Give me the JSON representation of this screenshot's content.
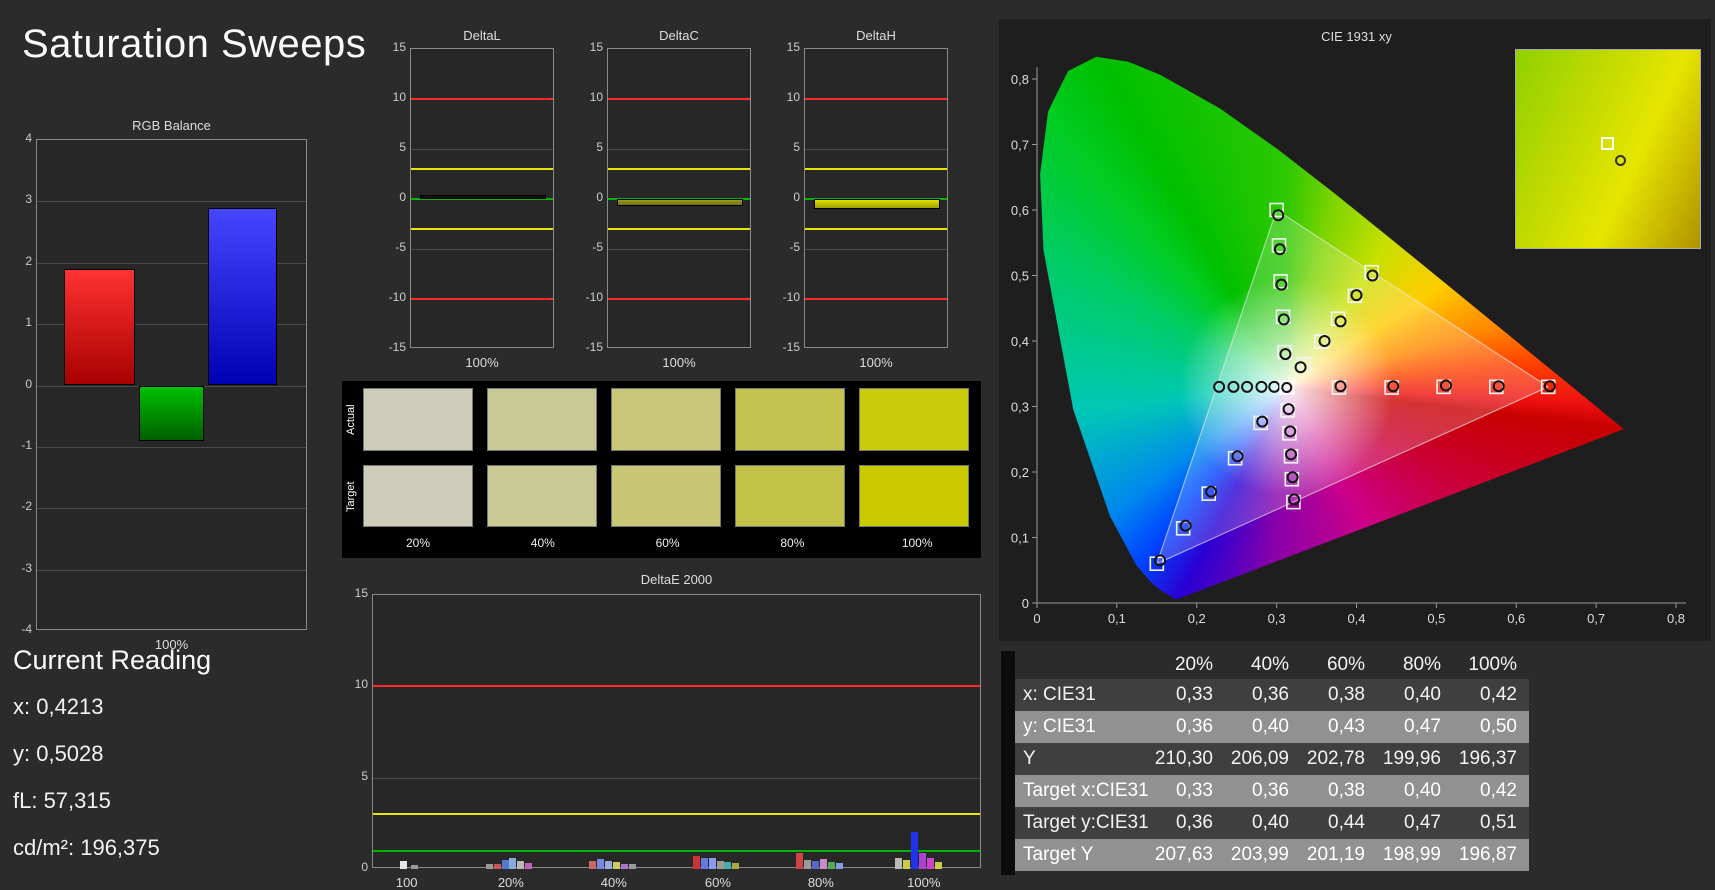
{
  "page": {
    "title": "Saturation Sweeps"
  },
  "current_reading": {
    "title": "Current Reading",
    "lines": [
      "x: 0,4213",
      "y: 0,5028",
      "fL: 57,315",
      "cd/m²: 196,375"
    ]
  },
  "swatches": {
    "col_labels": [
      "20%",
      "40%",
      "60%",
      "80%",
      "100%"
    ],
    "rows": [
      {
        "name": "Actual",
        "colors": [
          "#cdcdb9",
          "#c9c995",
          "#c8c878",
          "#c4c44e",
          "#cbcb0e"
        ]
      },
      {
        "name": "Target",
        "colors": [
          "#cdcdb9",
          "#c9c993",
          "#c7c775",
          "#c3c34a",
          "#c9c900"
        ]
      }
    ]
  },
  "chart_data": [
    {
      "id": "rgb_balance",
      "type": "bar",
      "title": "RGB Balance",
      "x_label": "100%",
      "ylim": [
        -4,
        4
      ],
      "yticks": [
        4,
        3,
        2,
        1,
        0,
        -1,
        -2,
        -3,
        -4
      ],
      "grid": [
        3,
        2,
        1,
        0,
        -1,
        -2,
        -3
      ],
      "slots": [
        [
          0.1,
          0.36
        ],
        [
          0.375,
          0.615
        ],
        [
          0.63,
          0.885
        ]
      ],
      "series": [
        {
          "name": "Red",
          "value": 1.9,
          "color": "#ff3232",
          "color2": "#a80000"
        },
        {
          "name": "Green",
          "value": -0.9,
          "color": "#00c000",
          "color2": "#006000"
        },
        {
          "name": "Blue",
          "value": 2.9,
          "color": "#4646ff",
          "color2": "#0000b4"
        }
      ]
    },
    {
      "id": "deltaL",
      "type": "bar",
      "title": "DeltaL",
      "x_label": "100%",
      "ylim": [
        -15,
        15
      ],
      "yticks": [
        15,
        10,
        5,
        0,
        -5,
        -10,
        -15
      ],
      "grid": [
        5,
        -5
      ],
      "ref_lines": [
        {
          "value": 10,
          "color": "#ff2a2a"
        },
        {
          "value": 3,
          "color": "#e6e600"
        },
        {
          "value": 0,
          "color": "#00b400"
        },
        {
          "value": -3,
          "color": "#e6e600"
        },
        {
          "value": -10,
          "color": "#ff2a2a"
        }
      ],
      "slots": [
        [
          0.06,
          0.94
        ]
      ],
      "series": [
        {
          "name": "DeltaL",
          "value": 0.4,
          "color": "#161616",
          "color2": "#050505"
        }
      ]
    },
    {
      "id": "deltaC",
      "type": "bar",
      "title": "DeltaC",
      "x_label": "100%",
      "ylim": [
        -15,
        15
      ],
      "yticks": [
        15,
        10,
        5,
        0,
        -5,
        -10,
        -15
      ],
      "grid": [
        5,
        -5
      ],
      "ref_lines": [
        {
          "value": 10,
          "color": "#ff2a2a"
        },
        {
          "value": 3,
          "color": "#e6e600"
        },
        {
          "value": 0,
          "color": "#00b400"
        },
        {
          "value": -3,
          "color": "#e6e600"
        },
        {
          "value": -10,
          "color": "#ff2a2a"
        }
      ],
      "slots": [
        [
          0.06,
          0.94
        ]
      ],
      "series": [
        {
          "name": "DeltaC",
          "value": -0.7,
          "color": "#9c9c24",
          "color2": "#6f6f12"
        }
      ]
    },
    {
      "id": "deltaH",
      "type": "bar",
      "title": "DeltaH",
      "x_label": "100%",
      "ylim": [
        -15,
        15
      ],
      "yticks": [
        15,
        10,
        5,
        0,
        -5,
        -10,
        -15
      ],
      "grid": [
        5,
        -5
      ],
      "ref_lines": [
        {
          "value": 10,
          "color": "#ff2a2a"
        },
        {
          "value": 3,
          "color": "#e6e600"
        },
        {
          "value": 0,
          "color": "#00b400"
        },
        {
          "value": -3,
          "color": "#e6e600"
        },
        {
          "value": -10,
          "color": "#ff2a2a"
        }
      ],
      "slots": [
        [
          0.06,
          0.94
        ]
      ],
      "series": [
        {
          "name": "DeltaH",
          "value": -1.0,
          "color": "#e0e000",
          "color2": "#a0a000"
        }
      ]
    },
    {
      "id": "deltaE",
      "type": "bar",
      "title": "DeltaE 2000",
      "ylim": [
        0,
        15
      ],
      "yticks": [
        15,
        10,
        5,
        0
      ],
      "grid": [
        5
      ],
      "ref_lines": [
        {
          "value": 10,
          "color": "#ff2a2a"
        },
        {
          "value": 3,
          "color": "#e6e600"
        },
        {
          "value": 1,
          "color": "#00b400"
        }
      ],
      "x_ticks": [
        {
          "pos": 0.057,
          "label": "100"
        },
        {
          "pos": 0.228,
          "label": "20%"
        },
        {
          "pos": 0.397,
          "label": "40%"
        },
        {
          "pos": 0.568,
          "label": "60%"
        },
        {
          "pos": 0.737,
          "label": "80%"
        },
        {
          "pos": 0.906,
          "label": "100%"
        }
      ],
      "bars": [
        {
          "pos": 0.05,
          "value": 0.45,
          "color": "#e8e8e8"
        },
        {
          "pos": 0.068,
          "value": 0.2,
          "color": "#9a9a9a"
        },
        {
          "pos": 0.19,
          "value": 0.3,
          "color": "#9a9a9a"
        },
        {
          "pos": 0.203,
          "value": 0.28,
          "color": "#cc5555"
        },
        {
          "pos": 0.216,
          "value": 0.5,
          "color": "#5577cc"
        },
        {
          "pos": 0.229,
          "value": 0.6,
          "color": "#88aadd"
        },
        {
          "pos": 0.242,
          "value": 0.42,
          "color": "#b9b9b9"
        },
        {
          "pos": 0.255,
          "value": 0.34,
          "color": "#bb66bb"
        },
        {
          "pos": 0.36,
          "value": 0.42,
          "color": "#cc6666"
        },
        {
          "pos": 0.373,
          "value": 0.55,
          "color": "#7788dd"
        },
        {
          "pos": 0.386,
          "value": 0.46,
          "color": "#99aadd"
        },
        {
          "pos": 0.399,
          "value": 0.36,
          "color": "#cccc66"
        },
        {
          "pos": 0.412,
          "value": 0.3,
          "color": "#aa77cc"
        },
        {
          "pos": 0.425,
          "value": 0.26,
          "color": "#9a9a9a"
        },
        {
          "pos": 0.53,
          "value": 0.72,
          "color": "#cc3333"
        },
        {
          "pos": 0.543,
          "value": 0.58,
          "color": "#6677dd"
        },
        {
          "pos": 0.556,
          "value": 0.62,
          "color": "#8899ee"
        },
        {
          "pos": 0.569,
          "value": 0.46,
          "color": "#9a9a9a"
        },
        {
          "pos": 0.582,
          "value": 0.4,
          "color": "#44aaaa"
        },
        {
          "pos": 0.595,
          "value": 0.34,
          "color": "#aaaa44"
        },
        {
          "pos": 0.7,
          "value": 0.85,
          "color": "#cc4444"
        },
        {
          "pos": 0.713,
          "value": 0.5,
          "color": "#9a9a9a"
        },
        {
          "pos": 0.726,
          "value": 0.46,
          "color": "#5566cc"
        },
        {
          "pos": 0.739,
          "value": 0.56,
          "color": "#cc88cc"
        },
        {
          "pos": 0.752,
          "value": 0.4,
          "color": "#55aa55"
        },
        {
          "pos": 0.765,
          "value": 0.34,
          "color": "#8899dd"
        },
        {
          "pos": 0.862,
          "value": 0.6,
          "color": "#b9b9b9"
        },
        {
          "pos": 0.875,
          "value": 0.5,
          "color": "#cccc44"
        },
        {
          "pos": 0.888,
          "value": 2.05,
          "color": "#2233ee"
        },
        {
          "pos": 0.901,
          "value": 0.85,
          "color": "#aa44cc"
        },
        {
          "pos": 0.914,
          "value": 0.62,
          "color": "#cc44cc"
        },
        {
          "pos": 0.927,
          "value": 0.38,
          "color": "#cccc44"
        }
      ]
    }
  ],
  "cie": {
    "title": "CIE 1931 xy",
    "x_ticks": [
      "0",
      "0,1",
      "0,2",
      "0,3",
      "0,4",
      "0,5",
      "0,6",
      "0,7",
      "0,8"
    ],
    "y_ticks": [
      "0",
      "0,1",
      "0,2",
      "0,3",
      "0,4",
      "0,5",
      "0,6",
      "0,7",
      "0,8"
    ],
    "white_point": [
      0.3127,
      0.329
    ],
    "gamut": [
      [
        0.64,
        0.33
      ],
      [
        0.3,
        0.6
      ],
      [
        0.15,
        0.06
      ]
    ],
    "locus": [
      [
        0.1741,
        0.005
      ],
      [
        0.1566,
        0.0177
      ],
      [
        0.144,
        0.0297
      ],
      [
        0.1241,
        0.0578
      ],
      [
        0.0913,
        0.1327
      ],
      [
        0.0454,
        0.295
      ],
      [
        0.0082,
        0.5384
      ],
      [
        0.0039,
        0.6548
      ],
      [
        0.0139,
        0.7502
      ],
      [
        0.0389,
        0.812
      ],
      [
        0.0743,
        0.8338
      ],
      [
        0.1142,
        0.8262
      ],
      [
        0.1547,
        0.8059
      ],
      [
        0.2296,
        0.7543
      ],
      [
        0.3016,
        0.6923
      ],
      [
        0.3731,
        0.6245
      ],
      [
        0.4441,
        0.5547
      ],
      [
        0.5125,
        0.4866
      ],
      [
        0.5752,
        0.4242
      ],
      [
        0.627,
        0.3725
      ],
      [
        0.6658,
        0.334
      ],
      [
        0.6915,
        0.3083
      ],
      [
        0.719,
        0.2809
      ],
      [
        0.7347,
        0.2653
      ]
    ],
    "targets": [
      [
        0.378,
        0.329
      ],
      [
        0.444,
        0.329
      ],
      [
        0.509,
        0.33
      ],
      [
        0.575,
        0.33
      ],
      [
        0.64,
        0.33
      ],
      [
        0.31,
        0.383
      ],
      [
        0.308,
        0.437
      ],
      [
        0.305,
        0.491
      ],
      [
        0.303,
        0.546
      ],
      [
        0.3,
        0.6
      ],
      [
        0.28,
        0.275
      ],
      [
        0.248,
        0.221
      ],
      [
        0.215,
        0.167
      ],
      [
        0.183,
        0.114
      ],
      [
        0.15,
        0.06
      ],
      [
        0.314,
        0.294
      ],
      [
        0.316,
        0.259
      ],
      [
        0.318,
        0.224
      ],
      [
        0.319,
        0.189
      ],
      [
        0.321,
        0.154
      ],
      [
        0.334,
        0.364
      ],
      [
        0.356,
        0.399
      ],
      [
        0.377,
        0.434
      ],
      [
        0.398,
        0.469
      ],
      [
        0.419,
        0.505
      ]
    ],
    "measured": [
      [
        0.38,
        0.331
      ],
      [
        0.446,
        0.331
      ],
      [
        0.512,
        0.332
      ],
      [
        0.578,
        0.331
      ],
      [
        0.642,
        0.331
      ],
      [
        0.311,
        0.38
      ],
      [
        0.309,
        0.433
      ],
      [
        0.306,
        0.486
      ],
      [
        0.304,
        0.54
      ],
      [
        0.302,
        0.592
      ],
      [
        0.282,
        0.277
      ],
      [
        0.251,
        0.224
      ],
      [
        0.218,
        0.17
      ],
      [
        0.186,
        0.118
      ],
      [
        0.154,
        0.065
      ],
      [
        0.297,
        0.33
      ],
      [
        0.281,
        0.33
      ],
      [
        0.263,
        0.33
      ],
      [
        0.246,
        0.33
      ],
      [
        0.228,
        0.33
      ],
      [
        0.315,
        0.296
      ],
      [
        0.317,
        0.262
      ],
      [
        0.318,
        0.227
      ],
      [
        0.32,
        0.192
      ],
      [
        0.322,
        0.158
      ],
      [
        0.33,
        0.36
      ],
      [
        0.36,
        0.4
      ],
      [
        0.38,
        0.43
      ],
      [
        0.4,
        0.47
      ],
      [
        0.42,
        0.5
      ]
    ]
  },
  "table": {
    "columns": [
      "20%",
      "40%",
      "60%",
      "80%",
      "100%"
    ],
    "rows": [
      {
        "label": "x: CIE31",
        "values": [
          "0,33",
          "0,36",
          "0,38",
          "0,40",
          "0,42"
        ]
      },
      {
        "label": "y: CIE31",
        "values": [
          "0,36",
          "0,40",
          "0,43",
          "0,47",
          "0,50"
        ]
      },
      {
        "label": "Y",
        "values": [
          "210,30",
          "206,09",
          "202,78",
          "199,96",
          "196,37"
        ]
      },
      {
        "label": "Target x:CIE31",
        "values": [
          "0,33",
          "0,36",
          "0,38",
          "0,40",
          "0,42"
        ]
      },
      {
        "label": "Target y:CIE31",
        "values": [
          "0,36",
          "0,40",
          "0,44",
          "0,47",
          "0,51"
        ]
      },
      {
        "label": "Target Y",
        "values": [
          "207,63",
          "203,99",
          "201,19",
          "198,99",
          "196,87"
        ]
      }
    ]
  }
}
